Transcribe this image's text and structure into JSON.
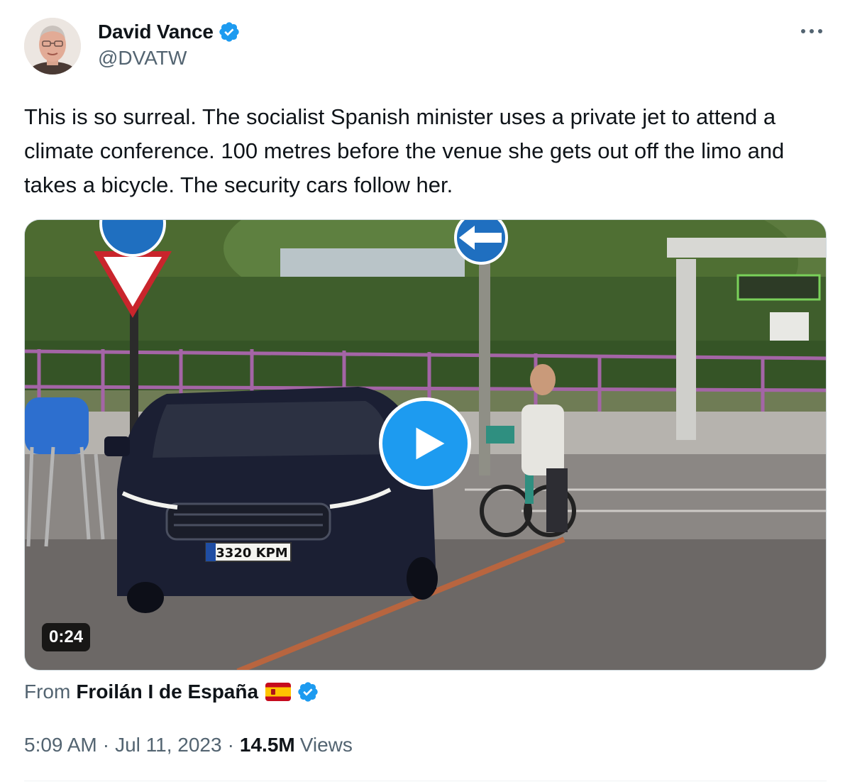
{
  "author": {
    "display_name": "David Vance",
    "handle": "@DVATW",
    "verified": true
  },
  "tweet": {
    "text": "This is so surreal. The socialist Spanish minister uses a private jet to attend a climate conference. 100 metres before the venue she gets out off the limo and takes a bicycle. The security cars follow her."
  },
  "media": {
    "type": "video",
    "duration": "0:24",
    "license_plate": "3320 KPM"
  },
  "attribution": {
    "prefix": "From",
    "source_name": "Froilán I de España",
    "source_verified": true,
    "flag_icon": "spain-flag-icon"
  },
  "meta": {
    "time": "5:09 AM",
    "separator": "·",
    "date": "Jul 11, 2023",
    "views_count": "14.5M",
    "views_label": "Views"
  },
  "colors": {
    "accent": "#1d9bf0",
    "text_primary": "#0f1419",
    "text_secondary": "#536471"
  }
}
